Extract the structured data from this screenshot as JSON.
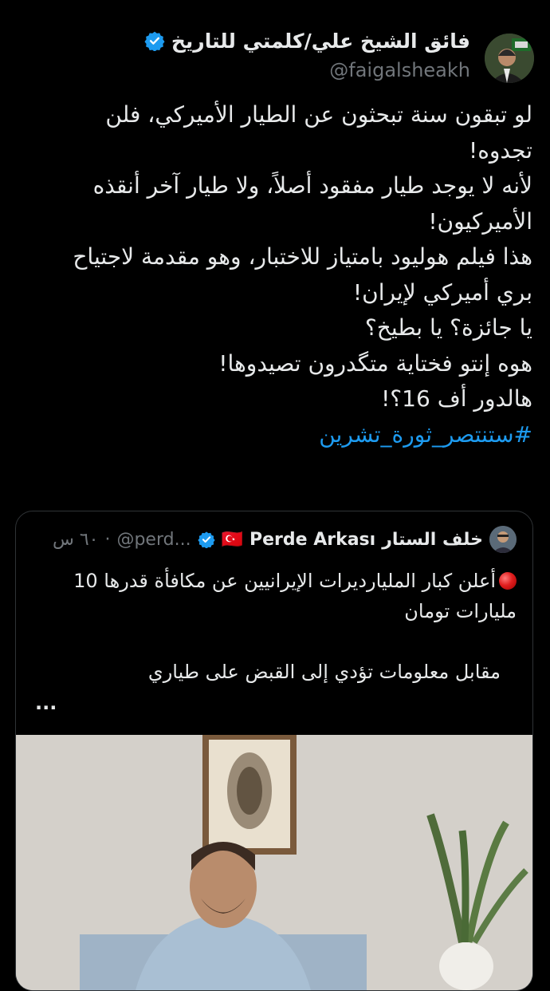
{
  "tweet": {
    "author_name": "فائق الشيخ علي/كلمتي للتاريخ",
    "handle": "@faigalsheakh",
    "text_lines": [
      "لو تبقون سنة تبحثون عن الطيار الأميركي، فلن",
      "تجدوه!",
      "لأنه لا يوجد طيار مفقود أصلاً، ولا طيار آخر أنقذه",
      "الأميركيون!",
      "هذا فيلم هوليود بامتياز للاختبار، وهو مقدمة لاجتياح",
      "بري أميركي لإيران!",
      "يا جائزة؟ يا بطيخ؟",
      "هوه إنتو فختاية متگدرون تصيدوها!",
      "هالدور أف 16؟!"
    ],
    "hashtag": "#ستنتصر_ثورة_تشرين"
  },
  "quoted": {
    "author_name": "خلف الستار",
    "author_name2": "Perde Arkası",
    "flag": "🇹🇷",
    "handle": "@perd...",
    "separator": "·",
    "time": "٦٠ س",
    "text_line1": "أعلن كبار المليارديرات الإيرانيين عن مكافأة قدرها 10",
    "text_line2": "مليارات تومان",
    "text_line3": "مقابل معلومات تؤدي إلى القبض على طياري",
    "more": "..."
  },
  "icons": {
    "verified": "verified-badge-icon",
    "red_circle": "red-circle-emoji-icon"
  },
  "colors": {
    "background": "#000000",
    "text": "#e7e9ea",
    "muted": "#71767b",
    "accent": "#1d9bf0",
    "border": "#2f3336"
  }
}
